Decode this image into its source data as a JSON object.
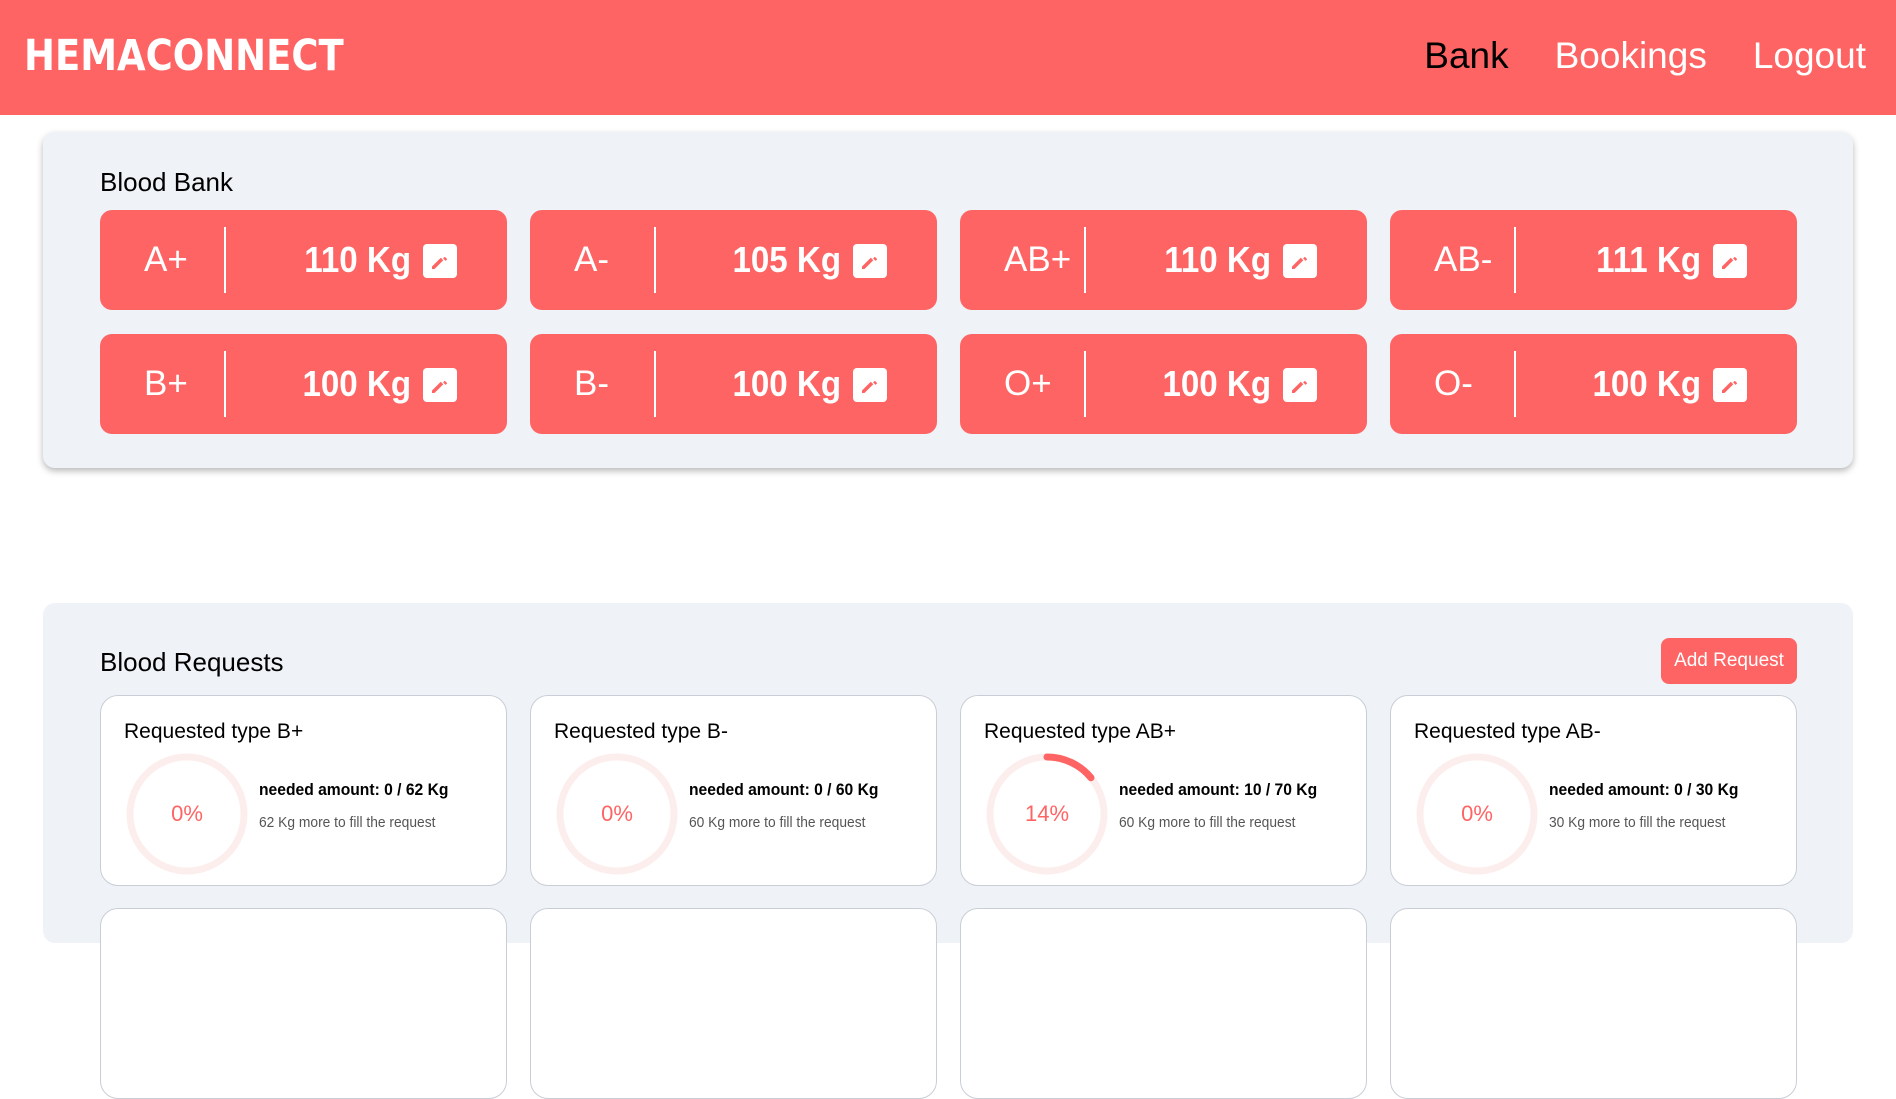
{
  "header": {
    "brand": "HEMACONNECT",
    "nav": [
      {
        "label": "Bank",
        "active": true
      },
      {
        "label": "Bookings",
        "active": false
      },
      {
        "label": "Logout",
        "active": false
      }
    ]
  },
  "blood_bank": {
    "title": "Blood Bank",
    "items": [
      {
        "type": "A+",
        "amount": "110 Kg"
      },
      {
        "type": "A-",
        "amount": "105 Kg"
      },
      {
        "type": "AB+",
        "amount": "110 Kg"
      },
      {
        "type": "AB-",
        "amount": "111 Kg"
      },
      {
        "type": "B+",
        "amount": "100 Kg"
      },
      {
        "type": "B-",
        "amount": "100 Kg"
      },
      {
        "type": "O+",
        "amount": "100 Kg"
      },
      {
        "type": "O-",
        "amount": "100 Kg"
      }
    ],
    "edit_icon": "pencil-icon"
  },
  "blood_requests": {
    "title": "Blood Requests",
    "add_button": "Add Request",
    "items": [
      {
        "title": "Requested type B+",
        "percent_label": "0%",
        "progress": 0,
        "needed": "needed amount: 0 / 62 Kg",
        "more": "62 Kg more to fill the request"
      },
      {
        "title": "Requested type B-",
        "percent_label": "0%",
        "progress": 0,
        "needed": "needed amount: 0 / 60 Kg",
        "more": "60 Kg more to fill the request"
      },
      {
        "title": "Requested type AB+",
        "percent_label": "14%",
        "progress": 0.14,
        "needed": "needed amount: 10 / 70 Kg",
        "more": "60 Kg more to fill the request"
      },
      {
        "title": "Requested type AB-",
        "percent_label": "0%",
        "progress": 0,
        "needed": "needed amount: 0 / 30 Kg",
        "more": "30 Kg more to fill the request"
      }
    ]
  },
  "colors": {
    "accent": "#ff6464",
    "panel_bg": "#eff2f7",
    "ring_track": "#fdeeee"
  }
}
